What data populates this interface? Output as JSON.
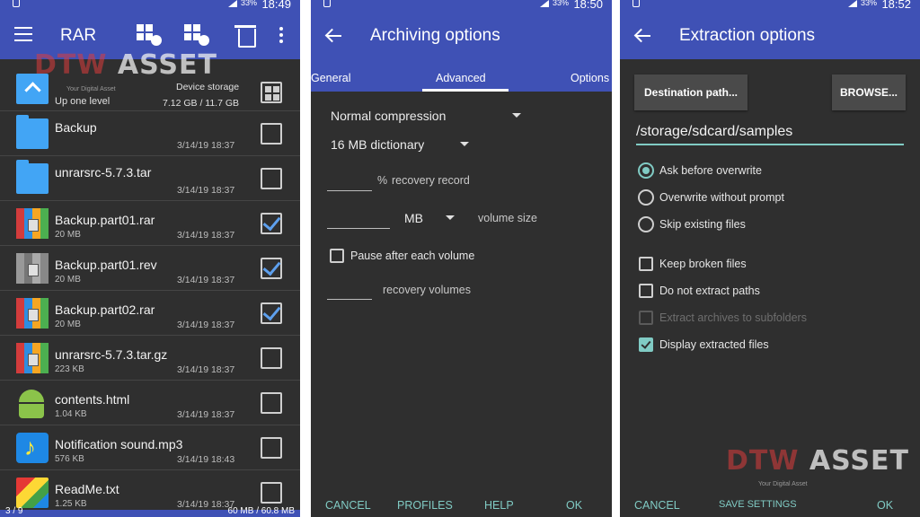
{
  "panel1": {
    "status": {
      "battery": "33%",
      "time": "18:49"
    },
    "title": "RAR",
    "watermark": {
      "brand": "DTW",
      "asset": "ASSET",
      "tagline": "Your Digital Asset"
    },
    "updir": {
      "label": "Up one level",
      "storage_label": "Device storage",
      "storage_value": "7.12 GB / 11.7 GB"
    },
    "files": [
      {
        "name": "Backup",
        "size": "",
        "date": "3/14/19 18:37",
        "icon": "folder-icon",
        "checked": false
      },
      {
        "name": "unrarsrc-5.7.3.tar",
        "size": "",
        "date": "3/14/19 18:37",
        "icon": "folder-icon",
        "checked": false
      },
      {
        "name": "Backup.part01.rar",
        "size": "20 MB",
        "date": "3/14/19 18:37",
        "icon": "rar-archive-icon",
        "checked": true
      },
      {
        "name": "Backup.part01.rev",
        "size": "20 MB",
        "date": "3/14/19 18:37",
        "icon": "rev-archive-icon",
        "checked": true
      },
      {
        "name": "Backup.part02.rar",
        "size": "20 MB",
        "date": "3/14/19 18:37",
        "icon": "rar-archive-icon",
        "checked": true
      },
      {
        "name": "unrarsrc-5.7.3.tar.gz",
        "size": "223 KB",
        "date": "3/14/19 18:37",
        "icon": "rar-archive-icon",
        "checked": false
      },
      {
        "name": "contents.html",
        "size": "1.04 KB",
        "date": "3/14/19 18:37",
        "icon": "android-icon",
        "checked": false
      },
      {
        "name": "Notification sound.mp3",
        "size": "576 KB",
        "date": "3/14/19 18:43",
        "icon": "music-icon",
        "checked": false
      },
      {
        "name": "ReadMe.txt",
        "size": "1.25 KB",
        "date": "3/14/19 18:37",
        "icon": "viewer-icon",
        "checked": false
      }
    ],
    "footer": {
      "left": "3 / 9",
      "right": "60 MB / 60.8 MB"
    }
  },
  "panel2": {
    "status": {
      "battery": "33%",
      "time": "18:50"
    },
    "title": "Archiving options",
    "tabs": [
      "General",
      "Advanced",
      "Options"
    ],
    "active_tab": "Advanced",
    "compression": "Normal compression",
    "dictionary": "16 MB dictionary",
    "recovery_unit": "%",
    "recovery_label": "recovery record",
    "volume_unit": "MB",
    "volume_label": "volume size",
    "pause_label": "Pause after each volume",
    "pause_checked": false,
    "recovery_volumes_label": "recovery volumes",
    "footer": [
      "CANCEL",
      "PROFILES",
      "HELP",
      "OK"
    ]
  },
  "panel3": {
    "status": {
      "battery": "33%",
      "time": "18:52"
    },
    "title": "Extraction options",
    "dest_button": "Destination path...",
    "browse_button": "BROWSE...",
    "path": "/storage/sdcard/samples",
    "radios": [
      {
        "label": "Ask before overwrite",
        "selected": true
      },
      {
        "label": "Overwrite without prompt",
        "selected": false
      },
      {
        "label": "Skip existing files",
        "selected": false
      }
    ],
    "checks": [
      {
        "label": "Keep broken files",
        "checked": false,
        "disabled": false
      },
      {
        "label": "Do not extract paths",
        "checked": false,
        "disabled": false
      },
      {
        "label": "Extract archives to subfolders",
        "checked": false,
        "disabled": true
      },
      {
        "label": "Display extracted files",
        "checked": true,
        "disabled": false
      }
    ],
    "watermark": {
      "brand": "DTW",
      "asset": "ASSET",
      "tagline": "Your Digital Asset"
    },
    "footer": [
      "CANCEL",
      "SAVE SETTINGS",
      "",
      "OK"
    ]
  },
  "colors": {
    "appbar": "#3f51b5",
    "accent": "#80cbc4",
    "background": "#2f2f2f",
    "checkmark": "#5ea0ee"
  }
}
